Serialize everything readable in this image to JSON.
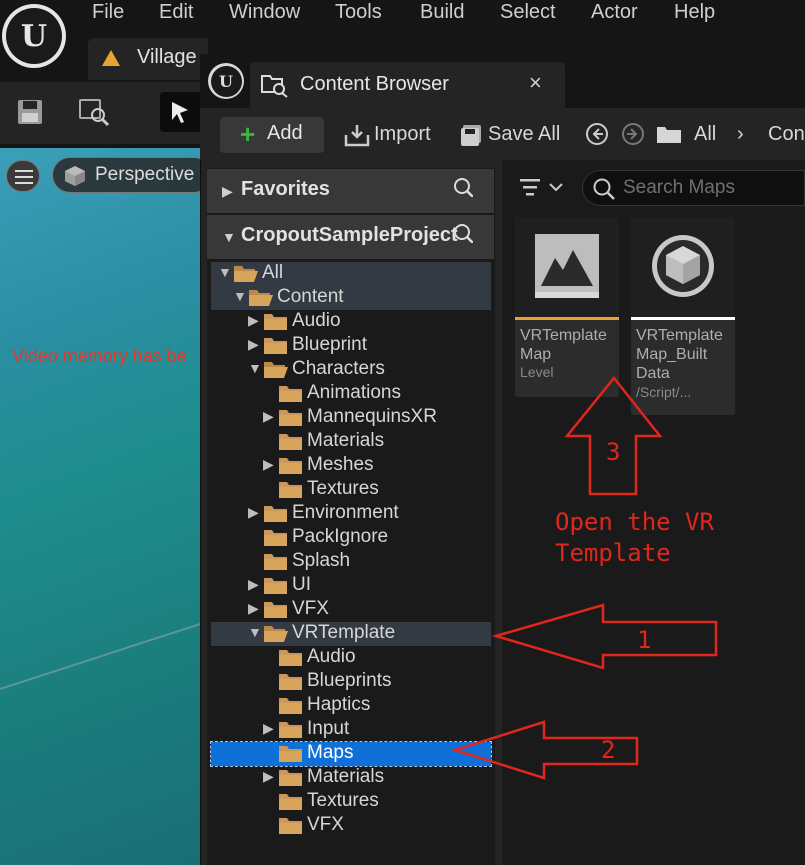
{
  "menubar": {
    "items": [
      "File",
      "Edit",
      "Window",
      "Tools",
      "Build",
      "Select",
      "Actor",
      "Help"
    ]
  },
  "level_tab": {
    "label": "Village"
  },
  "viewport": {
    "perspective_label": "Perspective",
    "error_text": "Video memory has be"
  },
  "content_browser": {
    "tab_title": "Content Browser",
    "close_glyph": "×",
    "toolbar": {
      "add": "Add",
      "import": "Import",
      "save_all": "Save All",
      "path_all": "All",
      "path_sep": "›",
      "path_next": "Con"
    },
    "favorites_label": "Favorites",
    "project_label": "CropoutSampleProject",
    "tree": [
      {
        "name": "All",
        "expanded": true,
        "highlight": true
      },
      {
        "name": "Content",
        "expanded": true,
        "highlight": true
      },
      {
        "name": "Audio",
        "has_children": true
      },
      {
        "name": "Blueprint",
        "has_children": true
      },
      {
        "name": "Characters",
        "expanded": true
      },
      {
        "name": "Animations"
      },
      {
        "name": "MannequinsXR",
        "has_children": true
      },
      {
        "name": "Materials"
      },
      {
        "name": "Meshes",
        "has_children": true
      },
      {
        "name": "Textures"
      },
      {
        "name": "Environment",
        "has_children": true
      },
      {
        "name": "PackIgnore"
      },
      {
        "name": "Splash"
      },
      {
        "name": "UI",
        "has_children": true
      },
      {
        "name": "VFX",
        "has_children": true
      },
      {
        "name": "VRTemplate",
        "expanded": true,
        "highlight": true
      },
      {
        "name": "Audio"
      },
      {
        "name": "Blueprints"
      },
      {
        "name": "Haptics"
      },
      {
        "name": "Input",
        "has_children": true
      },
      {
        "name": "Maps",
        "selected": true
      },
      {
        "name": "Materials",
        "has_children": true
      },
      {
        "name": "Textures"
      },
      {
        "name": "VFX"
      }
    ],
    "search_placeholder": "Search Maps",
    "assets": [
      {
        "name_line1": "VRTemplate",
        "name_line2": "Map",
        "type": "Level",
        "accent": "#e8a332"
      },
      {
        "name_line1": "VRTemplate",
        "name_line2": "Map_Built",
        "name_line3": "Data",
        "type": "/Script/...",
        "accent": "#ffffff"
      }
    ]
  },
  "annotations": {
    "label_1": "1",
    "label_2": "2",
    "label_3": "3",
    "note_line1": "Open the VR",
    "note_line2": "Template",
    "color": "#e0261d"
  }
}
